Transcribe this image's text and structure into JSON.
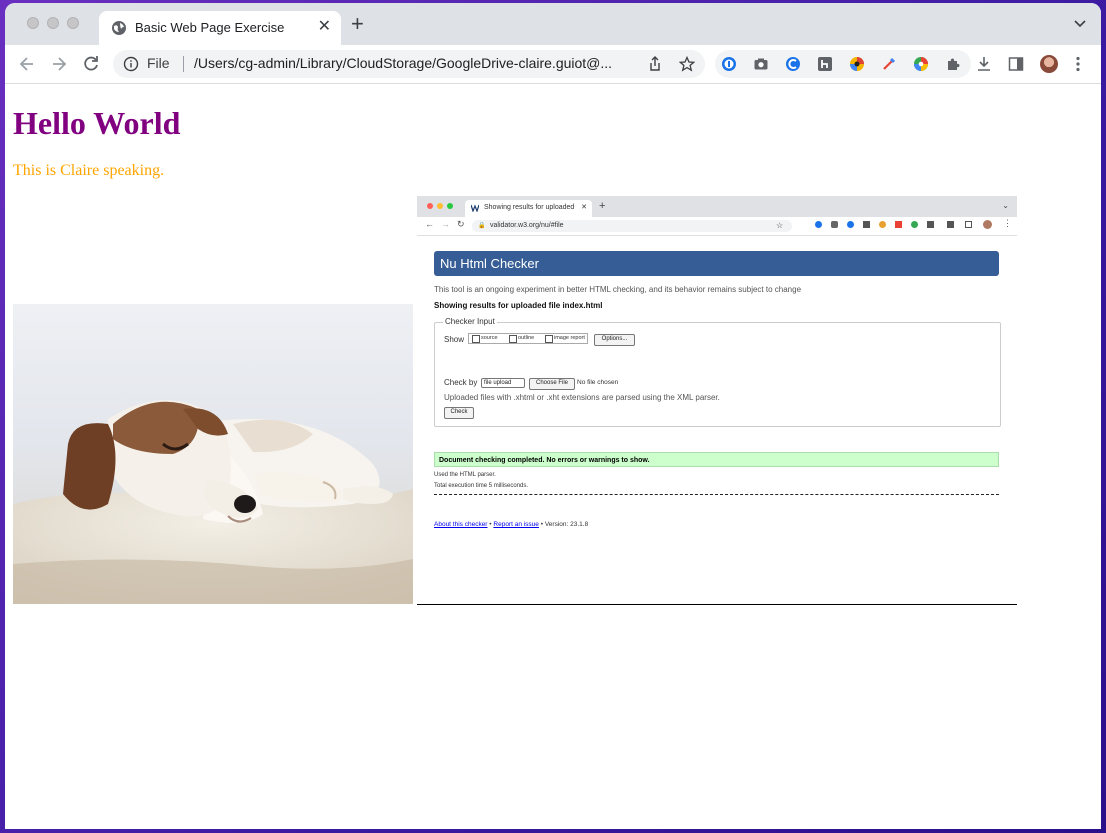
{
  "browser": {
    "tab_title": "Basic Web Page Exercise",
    "address_scheme": "File",
    "address_url": "/Users/cg-admin/Library/CloudStorage/GoogleDrive-claire.guiot@..."
  },
  "page": {
    "heading": "Hello World",
    "heading_color": "#800080",
    "paragraph": "This is Claire speaking.",
    "paragraph_color": "#ffa500",
    "dog_image_alt": "sleeping puppy"
  },
  "embedded_screenshot": {
    "tab_title": "Showing results for uploaded",
    "url": "validator.w3.org/nu/#file",
    "header": "Nu Html Checker",
    "intro": "This tool is an ongoing experiment in better HTML checking, and its behavior remains subject to change",
    "results_title": "Showing results for uploaded file index.html",
    "legend": "Checker Input",
    "show_label": "Show",
    "show_options": [
      "source",
      "outline",
      "image report"
    ],
    "options_button": "Options...",
    "check_by_label": "Check by",
    "check_by_value": "file upload",
    "choose_file_button": "Choose File",
    "no_file_text": "No file chosen",
    "xml_note": "Uploaded files with .xhtml or .xht extensions are parsed using the XML parser.",
    "check_button": "Check",
    "success_message": "Document checking completed. No errors or warnings to show.",
    "parser_note": "Used the HTML parser.",
    "execution_time": "Total execution time 5 milliseconds.",
    "footer_about": "About this checker",
    "footer_sep": "•",
    "footer_report": "Report an issue",
    "footer_version": "• Version: 23.1.8",
    "header_color": "#365d95",
    "success_color": "#ccffcc"
  }
}
